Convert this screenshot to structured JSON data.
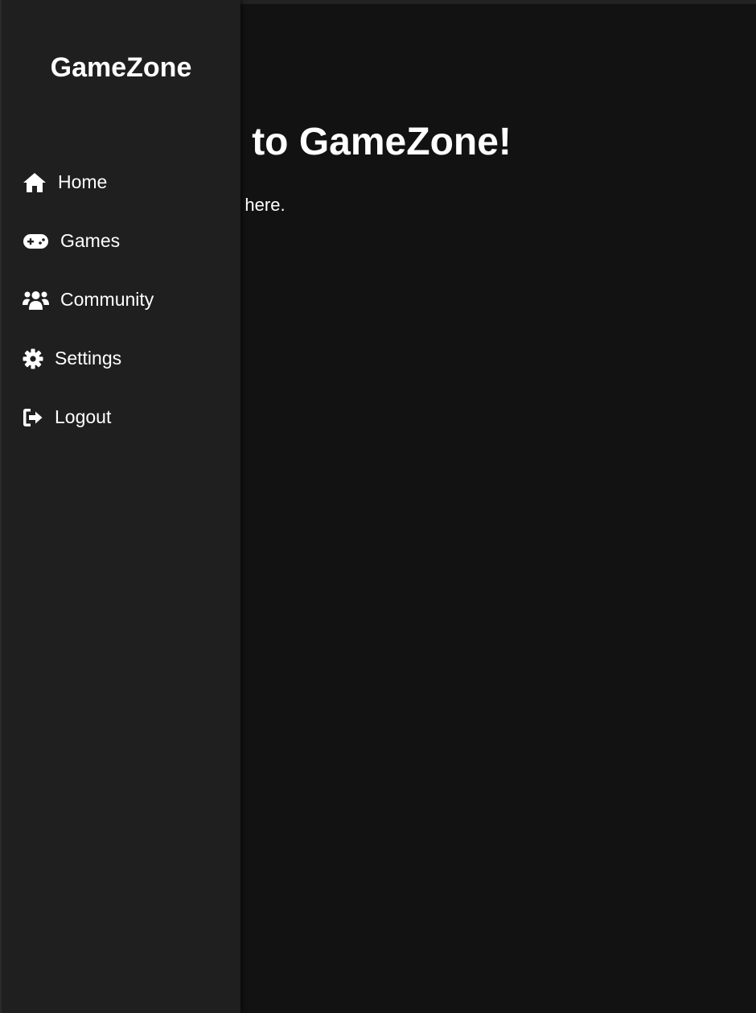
{
  "app": {
    "brand": "GameZone"
  },
  "sidebar": {
    "items": [
      {
        "label": "Home",
        "icon": "home-icon"
      },
      {
        "label": "Games",
        "icon": "gamepad-icon"
      },
      {
        "label": "Community",
        "icon": "users-icon"
      },
      {
        "label": "Settings",
        "icon": "gear-icon"
      },
      {
        "label": "Logout",
        "icon": "sign-out-icon"
      }
    ]
  },
  "main": {
    "heading": "Welcome to GameZone!",
    "subtitle": "Your adventure starts here."
  },
  "colors": {
    "sidebar_bg": "#1f1f1f",
    "main_bg": "#121212",
    "text": "#ffffff"
  }
}
